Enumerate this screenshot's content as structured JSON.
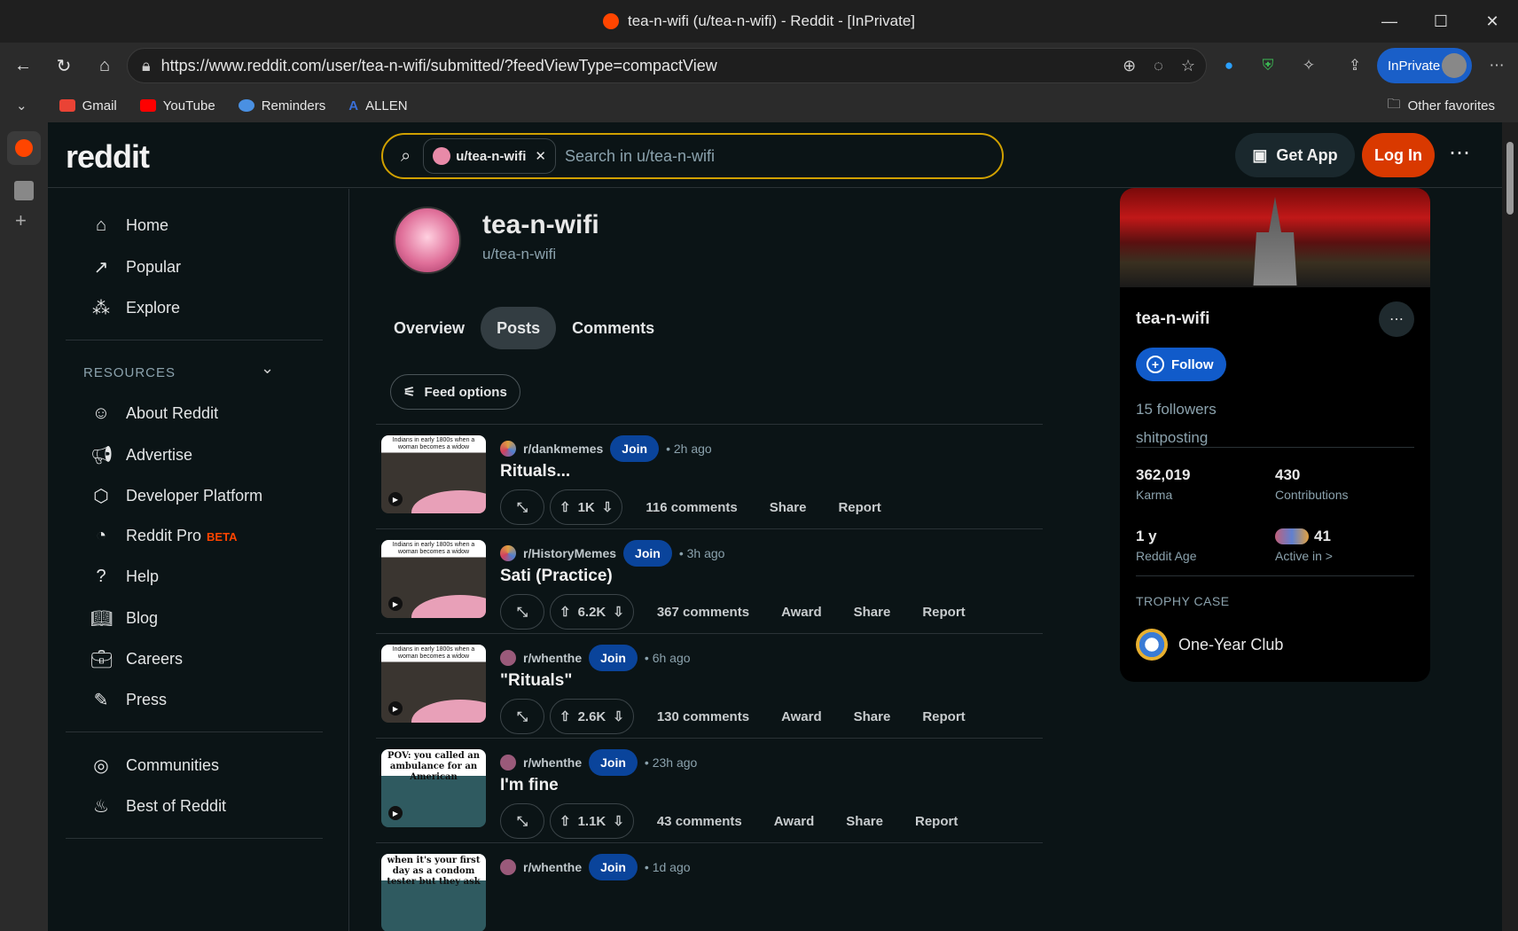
{
  "browser": {
    "title": "tea-n-wifi (u/tea-n-wifi) - Reddit - [InPrivate]",
    "url": "https://www.reddit.com/user/tea-n-wifi/submitted/?feedViewType=compactView",
    "inprivate_label": "InPrivate",
    "favorites": [
      "Gmail",
      "YouTube",
      "Reminders",
      "ALLEN"
    ],
    "other_favorites": "Other favorites"
  },
  "header": {
    "logo": "reddit",
    "search_chip": "u/tea-n-wifi",
    "search_placeholder": "Search in u/tea-n-wifi",
    "get_app": "Get App",
    "login": "Log In"
  },
  "leftnav": {
    "main": [
      {
        "label": "Home",
        "icon": "home-icon"
      },
      {
        "label": "Popular",
        "icon": "popular-icon"
      },
      {
        "label": "Explore",
        "icon": "explore-icon"
      }
    ],
    "resources_heading": "RESOURCES",
    "resources": [
      {
        "label": "About Reddit",
        "icon": "about-icon"
      },
      {
        "label": "Advertise",
        "icon": "megaphone-icon"
      },
      {
        "label": "Developer Platform",
        "icon": "developer-icon"
      },
      {
        "label": "Reddit Pro",
        "icon": "pro-icon"
      },
      {
        "label": "Help",
        "icon": "help-icon"
      },
      {
        "label": "Blog",
        "icon": "book-icon"
      },
      {
        "label": "Careers",
        "icon": "briefcase-icon"
      },
      {
        "label": "Press",
        "icon": "pen-icon"
      }
    ],
    "beta": "BETA",
    "communities": [
      {
        "label": "Communities",
        "icon": "communities-icon"
      },
      {
        "label": "Best of Reddit",
        "icon": "best-icon"
      }
    ]
  },
  "profile": {
    "name": "tea-n-wifi",
    "handle": "u/tea-n-wifi",
    "tabs": [
      "Overview",
      "Posts",
      "Comments"
    ],
    "active_tab": "Posts",
    "feed_options": "Feed options"
  },
  "posts": [
    {
      "sub": "r/dankmemes",
      "join": "Join",
      "time": "• 2h ago",
      "title": "Rituals...",
      "votes": "1K",
      "comments": "116 comments",
      "actions": [
        "Share",
        "Report"
      ],
      "thumb_caption": "Indians in early 1800s when a woman becomes a widow"
    },
    {
      "sub": "r/HistoryMemes",
      "join": "Join",
      "time": "• 3h ago",
      "title": "Sati (Practice)",
      "votes": "6.2K",
      "comments": "367 comments",
      "actions": [
        "Award",
        "Share",
        "Report"
      ],
      "thumb_caption": "Indians in early 1800s when a woman becomes a widow"
    },
    {
      "sub": "r/whenthe",
      "join": "Join",
      "time": "• 6h ago",
      "title": "\"Rituals\"",
      "votes": "2.6K",
      "comments": "130 comments",
      "actions": [
        "Award",
        "Share",
        "Report"
      ],
      "thumb_caption": "Indians in early 1800s when a woman becomes a widow"
    },
    {
      "sub": "r/whenthe",
      "join": "Join",
      "time": "• 23h ago",
      "title": "I'm fine",
      "votes": "1.1K",
      "comments": "43 comments",
      "actions": [
        "Award",
        "Share",
        "Report"
      ],
      "thumb_caption": "POV: you called an ambulance for an American"
    },
    {
      "sub": "r/whenthe",
      "join": "Join",
      "time": "• 1d ago",
      "title": "",
      "votes": "",
      "comments": "",
      "actions": [],
      "thumb_caption": "when it's your first day as a condom tester but they ask"
    }
  ],
  "card": {
    "name": "tea-n-wifi",
    "follow": "Follow",
    "followers": "15 followers",
    "description": "shitposting",
    "stats": [
      {
        "value": "362,019",
        "label": "Karma"
      },
      {
        "value": "430",
        "label": "Contributions"
      },
      {
        "value": "1 y",
        "label": "Reddit Age"
      },
      {
        "value": "41",
        "label": "Active in >"
      }
    ],
    "trophy_heading": "TROPHY CASE",
    "trophy": "One-Year Club"
  },
  "colors": {
    "accent": "#d93900",
    "join": "#0a449b",
    "follow": "#115bca",
    "bg": "#0b1416"
  }
}
